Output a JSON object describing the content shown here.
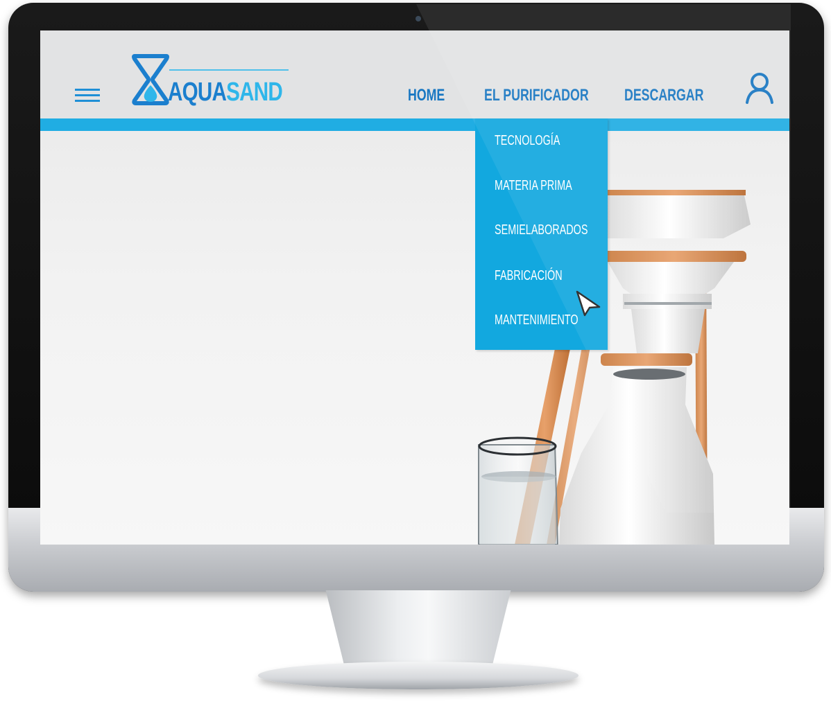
{
  "brand": {
    "aqua": "AQUA",
    "sand": "SAND"
  },
  "nav": {
    "links": [
      {
        "label": "HOME"
      },
      {
        "label": "EL PURIFICADOR"
      },
      {
        "label": "DESCARGAR"
      }
    ]
  },
  "dropdown": {
    "items": [
      {
        "label": "TECNOLOGÍA"
      },
      {
        "label": "MATERIA PRIMA"
      },
      {
        "label": "SEMIELABORADOS"
      },
      {
        "label": "FABRICACIÓN"
      },
      {
        "label": "MANTENIMIENTO"
      }
    ]
  },
  "icons": {
    "menu": "hamburger-menu-icon",
    "user": "user-icon",
    "logo": "hourglass-drop-logo",
    "cursor": "mouse-pointer-icon"
  },
  "colors": {
    "accent": "#20ade3",
    "brand_dark": "#1b7fce",
    "brand_light": "#2fb6ea",
    "dropdown_bg": "#12a8df",
    "nav_bg": "#e2e3e4",
    "wood": "#d9894a"
  }
}
